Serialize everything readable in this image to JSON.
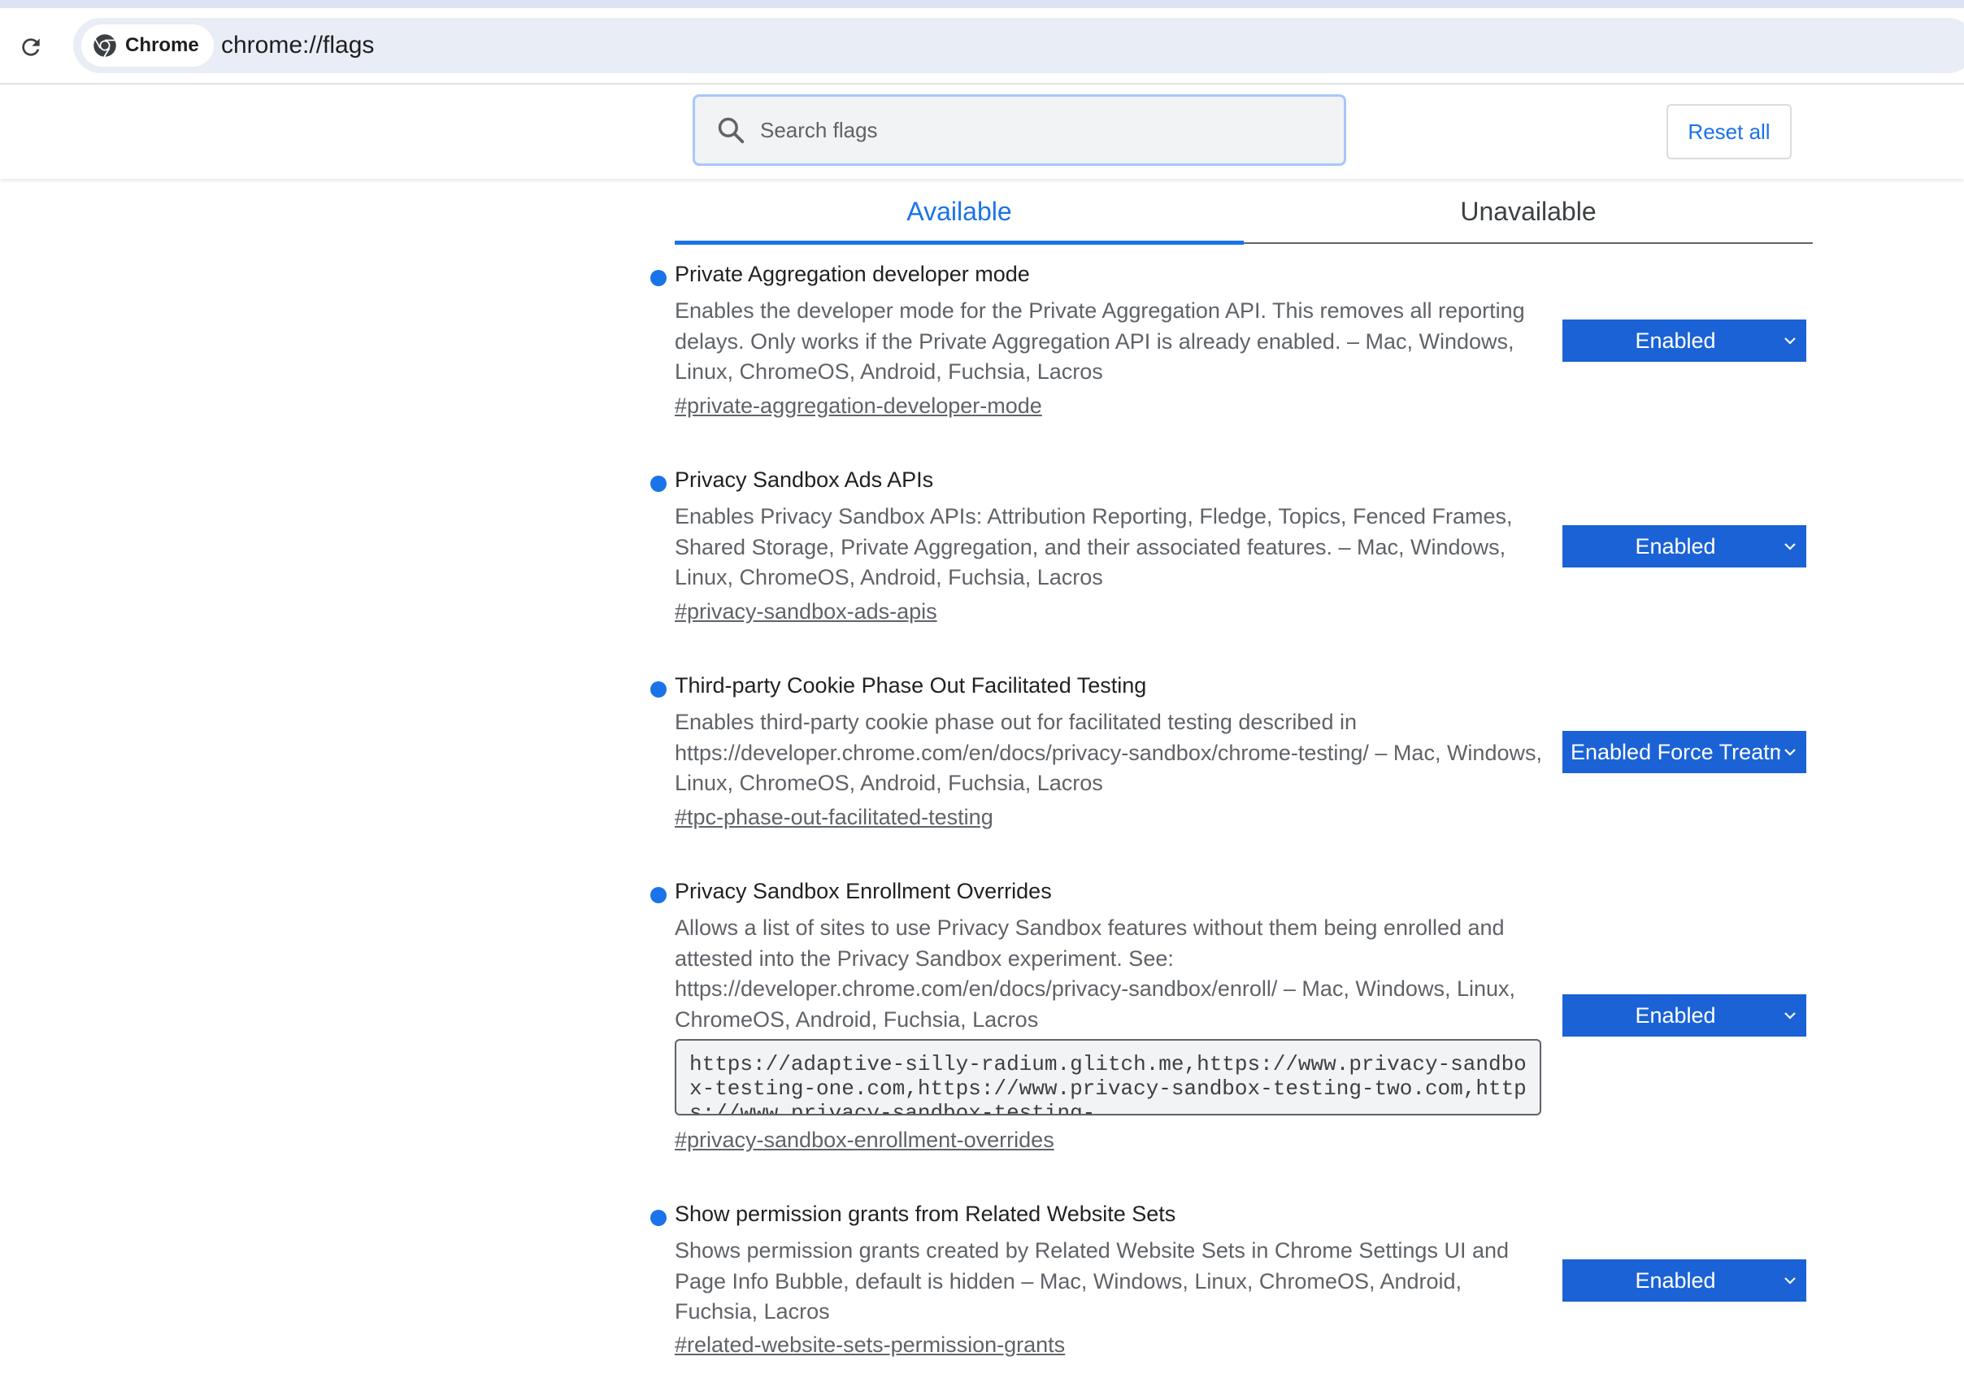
{
  "browser": {
    "site_chip_label": "Chrome",
    "url": "chrome://flags"
  },
  "header": {
    "search_placeholder": "Search flags",
    "reset_label": "Reset all"
  },
  "tabs": {
    "available": "Available",
    "unavailable": "Unavailable"
  },
  "experiments": [
    {
      "title": "Private Aggregation developer mode",
      "description": "Enables the developer mode for the Private Aggregation API. This removes all reporting delays. Only works if the Private Aggregation API is already enabled. – Mac, Windows, Linux, ChromeOS, Android, Fuchsia, Lacros",
      "link": "#private-aggregation-developer-mode",
      "selected": "Enabled"
    },
    {
      "title": "Privacy Sandbox Ads APIs",
      "description": "Enables Privacy Sandbox APIs: Attribution Reporting, Fledge, Topics, Fenced Frames, Shared Storage, Private Aggregation, and their associated features. – Mac, Windows, Linux, ChromeOS, Android, Fuchsia, Lacros",
      "link": "#privacy-sandbox-ads-apis",
      "selected": "Enabled"
    },
    {
      "title": "Third-party Cookie Phase Out Facilitated Testing",
      "description": "Enables third-party cookie phase out for facilitated testing described in https://developer.chrome.com/en/docs/privacy-sandbox/chrome-testing/ – Mac, Windows, Linux, ChromeOS, Android, Fuchsia, Lacros",
      "link": "#tpc-phase-out-facilitated-testing",
      "selected": "Enabled Force Treatm"
    },
    {
      "title": "Privacy Sandbox Enrollment Overrides",
      "description": "Allows a list of sites to use Privacy Sandbox features without them being enrolled and attested into the Privacy Sandbox experiment. See: https://developer.chrome.com/en/docs/privacy-sandbox/enroll/ – Mac, Windows, Linux, ChromeOS, Android, Fuchsia, Lacros",
      "override_value": "https://adaptive-silly-radium.glitch.me,https://www.privacy-sandbox-testing-one.com,https://www.privacy-sandbox-testing-two.com,https://www.privacy-sandbox-testing-",
      "link": "#privacy-sandbox-enrollment-overrides",
      "selected": "Enabled"
    },
    {
      "title": "Show permission grants from Related Website Sets",
      "description": "Shows permission grants created by Related Website Sets in Chrome Settings UI and Page Info Bubble, default is hidden – Mac, Windows, Linux, ChromeOS, Android, Fuchsia, Lacros",
      "link": "#related-website-sets-permission-grants",
      "selected": "Enabled"
    }
  ],
  "colors": {
    "accent": "#1a73e8",
    "select_bg": "#1a62d6",
    "omnibox_bg": "#e9edf6"
  },
  "icons": {
    "reload": "reload-icon",
    "chrome": "chrome-logo-icon",
    "search": "search-icon",
    "dropdown": "chevron-down-icon"
  }
}
